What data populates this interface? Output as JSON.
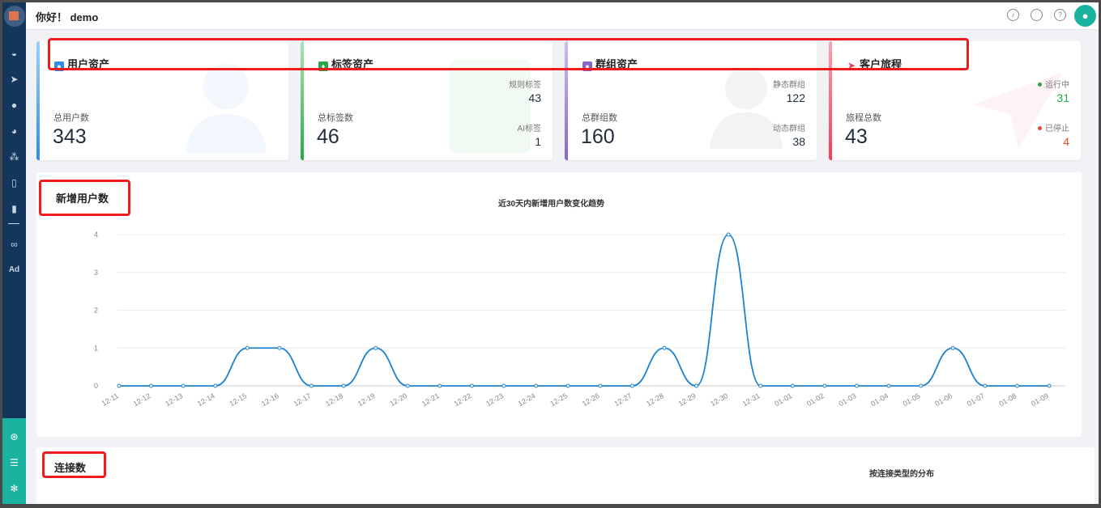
{
  "header": {
    "greeting": "你好！ demo",
    "icons": [
      "bell-icon",
      "chat-icon",
      "help-icon"
    ]
  },
  "sidebar": {
    "icons": [
      "dashboard-icon",
      "send-icon",
      "user-icon",
      "users-icon",
      "cluster-icon",
      "bookmark-icon",
      "bar-chart-icon",
      "wechat-icon"
    ],
    "ad_label": "Ad",
    "bottom_icons": [
      "hub-icon",
      "layers-icon",
      "gear-icon"
    ]
  },
  "cards": [
    {
      "title": "用户资产",
      "label": "总用户数",
      "value": "343",
      "color": "#2b8ee8"
    },
    {
      "title": "标签资产",
      "label": "总标签数",
      "value": "46",
      "color": "#27a84a",
      "stats": [
        {
          "label": "规则标签",
          "value": "43"
        },
        {
          "label": "AI标签",
          "value": "1"
        }
      ]
    },
    {
      "title": "群组资产",
      "label": "总群组数",
      "value": "160",
      "color": "#8a63c9",
      "stats": [
        {
          "label": "静态群组",
          "value": "122"
        },
        {
          "label": "动态群组",
          "value": "38"
        }
      ]
    },
    {
      "title": "客户旅程",
      "label": "旅程总数",
      "value": "43",
      "color": "#ee3e5e",
      "stats": [
        {
          "label": "运行中",
          "value": "31",
          "color": "#27a84a"
        },
        {
          "label": "已停止",
          "value": "4",
          "color": "#e8492b"
        }
      ]
    }
  ],
  "new_users": {
    "panel_title": "新增用户数",
    "chart_title": "近30天内新增用户数变化趋势"
  },
  "connections": {
    "panel_title": "连接数",
    "chart_title": "按连接类型的分布"
  },
  "chart_data": {
    "type": "line",
    "title": "近30天内新增用户数变化趋势",
    "xlabel": "",
    "ylabel": "",
    "categories": [
      "12-11",
      "12-12",
      "12-13",
      "12-14",
      "12-15",
      "12-16",
      "12-17",
      "12-18",
      "12-19",
      "12-20",
      "12-21",
      "12-22",
      "12-23",
      "12-24",
      "12-25",
      "12-26",
      "12-27",
      "12-28",
      "12-29",
      "12-30",
      "12-31",
      "01-01",
      "01-02",
      "01-03",
      "01-04",
      "01-05",
      "01-06",
      "01-07",
      "01-08",
      "01-09"
    ],
    "values": [
      0,
      0,
      0,
      0,
      1,
      1,
      0,
      0,
      1,
      0,
      0,
      0,
      0,
      0,
      0,
      0,
      0,
      1,
      0,
      4,
      0,
      0,
      0,
      0,
      0,
      0,
      1,
      0,
      0,
      0
    ],
    "ylim": [
      0,
      4
    ],
    "yticks": [
      0,
      1,
      2,
      3,
      4
    ],
    "grid": true,
    "smooth": true,
    "color": "#1f82cf"
  }
}
